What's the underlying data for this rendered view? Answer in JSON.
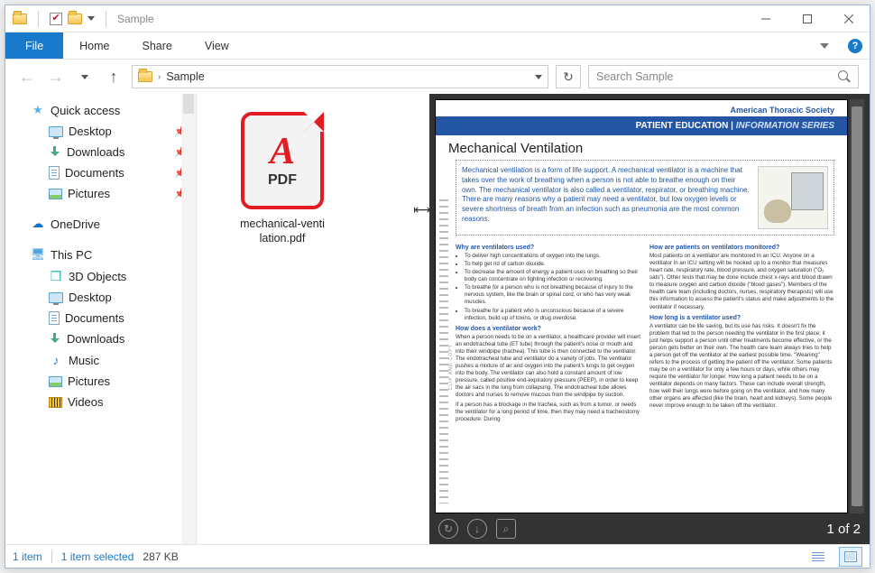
{
  "window": {
    "title": "Sample"
  },
  "ribbon": {
    "file": "File",
    "tabs": [
      "Home",
      "Share",
      "View"
    ]
  },
  "address": {
    "crumbs": [
      "Sample"
    ],
    "search_placeholder": "Search Sample"
  },
  "nav": {
    "quick_access": {
      "label": "Quick access",
      "items": [
        {
          "label": "Desktop",
          "pinned": true
        },
        {
          "label": "Downloads",
          "pinned": true
        },
        {
          "label": "Documents",
          "pinned": true
        },
        {
          "label": "Pictures",
          "pinned": true
        }
      ]
    },
    "onedrive": {
      "label": "OneDrive"
    },
    "thispc": {
      "label": "This PC",
      "items": [
        {
          "label": "3D Objects"
        },
        {
          "label": "Desktop"
        },
        {
          "label": "Documents"
        },
        {
          "label": "Downloads"
        },
        {
          "label": "Music"
        },
        {
          "label": "Pictures"
        },
        {
          "label": "Videos"
        }
      ]
    }
  },
  "files": [
    {
      "name": "mechanical-ventilation.pdf",
      "display_name": "mechanical-venti\nlation.pdf",
      "type": "pdf"
    }
  ],
  "preview": {
    "org": "American Thoracic Society",
    "band_left": "PATIENT EDUCATION",
    "band_right": "INFORMATION SERIES",
    "title": "Mechanical Ventilation",
    "intro": "Mechanical ventilation is a form of life support. A mechanical ventilator is a machine that takes over the work of breathing when a person is not able to breathe enough on their own. The mechanical ventilator is also called a ventilator, respirator, or breathing machine. There are many reasons why a patient may need a ventilator, but low oxygen levels or severe shortness of breath from an infection such as pneumonia are the most common reasons.",
    "side_label": "CLIP AND COPY",
    "col1": {
      "h1": "Why are ventilators used?",
      "b1": [
        "To deliver high concentrations of oxygen into the lungs.",
        "To help get rid of carbon dioxide.",
        "To decrease the amount of energy a patient uses on breathing so their body can concentrate on fighting infection or recovering.",
        "To breathe for a person who is not breathing because of injury to the nervous system, like the brain or spinal cord, or who has very weak muscles.",
        "To breathe for a patient who is unconscious because of a severe infection, build up of toxins, or drug overdose."
      ],
      "h2": "How does a ventilator work?",
      "p2": "When a person needs to be on a ventilator, a healthcare provider will insert an endotracheal tube (ET tube) through the patient's nose or mouth and into their windpipe (trachea). This tube is then connected to the ventilator. The endotracheal tube and ventilator do a variety of jobs. The ventilator pushes a mixture of air and oxygen into the patient's lungs to get oxygen into the body. The ventilator can also hold a constant amount of low pressure, called positive end-expiratory pressure (PEEP), in order to keep the air sacs in the lung from collapsing. The endotracheal tube allows doctors and nurses to remove mucous from the windpipe by suction.",
      "p3": "If a person has a blockage in the trachea, such as from a tumor, or needs the ventilator for a long period of time, then they may need a tracheostomy procedure. During"
    },
    "col2": {
      "h1": "How are patients on ventilators monitored?",
      "p1": "Most patients on a ventilator are monitored in an ICU. Anyone on a ventilator in an ICU setting will be hooked up to a monitor that measures heart rate, respiratory rate, blood pressure, and oxygen saturation (\"O₂ sats\"). Other tests that may be done include chest x-rays and blood drawn to measure oxygen and carbon dioxide (\"blood gases\"). Members of the health care team (including doctors, nurses, respiratory therapists) will use this information to assess the patient's status and make adjustments to the ventilator if necessary.",
      "h2": "How long is a ventilator used?",
      "p2": "A ventilator can be life saving, but its use has risks. It doesn't fix the problem that led to the person needing the ventilator in the first place; it just helps support a person until other treatments become effective, or the person gets better on their own. The health care team always tries to help a person get off the ventilator at the earliest possible time. \"Weaning\" refers to the process of getting the patient off the ventilator. Some patients may be on a ventilator for only a few hours or days, while others may require the ventilator for longer. How long a patient needs to be on a ventilator depends on many factors. These can include overall strength, how well their lungs were before going on the ventilator, and how many other organs are affected (like the brain, heart and kidneys). Some people never improve enough to be taken off the ventilator."
    },
    "page_indicator": "1 of 2"
  },
  "status": {
    "item_count": "1 item",
    "selection": "1 item selected",
    "size": "287 KB"
  }
}
